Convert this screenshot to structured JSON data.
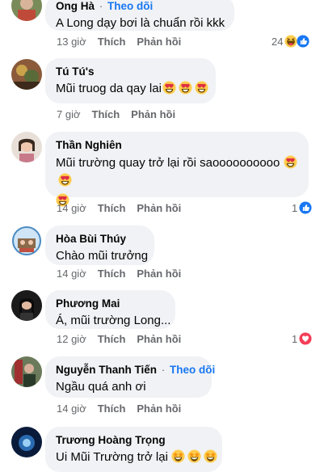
{
  "comments": [
    {
      "name": "Ong Hà",
      "follow": "Theo dõi",
      "text": "A Long dạy bơi là chuẩn rồi kkk",
      "time": "13 giờ",
      "like": "Thích",
      "reply": "Phản hồi",
      "reaction_count": "24",
      "reactions": [
        "haha-icon",
        "like-icon"
      ]
    },
    {
      "name": "Tú Tú's",
      "text": "Mũi truog da qay lai",
      "emojis": [
        "heart-eyes-emoji",
        "heart-eyes-emoji",
        "heart-eyes-emoji"
      ],
      "time": "7 giờ",
      "like": "Thích",
      "reply": "Phản hồi"
    },
    {
      "name": "Thần Nghiên",
      "text": "Mũi trường quay trở lại rồi saoooooooooo",
      "emojis": [
        "heart-eyes-emoji",
        "heart-eyes-emoji",
        "heart-eyes-emoji"
      ],
      "time": "14 giờ",
      "like": "Thích",
      "reply": "Phản hồi",
      "reaction_count": "1",
      "reactions": [
        "like-icon"
      ]
    },
    {
      "name": "Hòa Bùi Thúy",
      "text": "Chào mũi trưởng",
      "time": "14 giờ",
      "like": "Thích",
      "reply": "Phản hồi"
    },
    {
      "name": "Phương Mai",
      "text": "Á, mũi trường Long...",
      "time": "12 giờ",
      "like": "Thích",
      "reply": "Phản hồi",
      "reaction_count": "1",
      "reactions": [
        "love-icon"
      ]
    },
    {
      "name": "Nguyễn Thanh Tiến",
      "follow": "Theo dõi",
      "text": "Ngầu quá anh ơi",
      "time": "14 giờ",
      "like": "Thích",
      "reply": "Phản hồi"
    },
    {
      "name": "Trương Hoàng Trọng",
      "text": "Ui Mũi Trường trở lại",
      "emojis": [
        "star-struck-emoji",
        "star-struck-emoji",
        "star-struck-emoji"
      ]
    }
  ],
  "colors": {
    "bubble": "#f0f2f5",
    "follow": "#1877f2",
    "meta": "#65676b",
    "like": "#1877f2",
    "love": "#f33e58",
    "emoji": "#ffcc4d"
  }
}
